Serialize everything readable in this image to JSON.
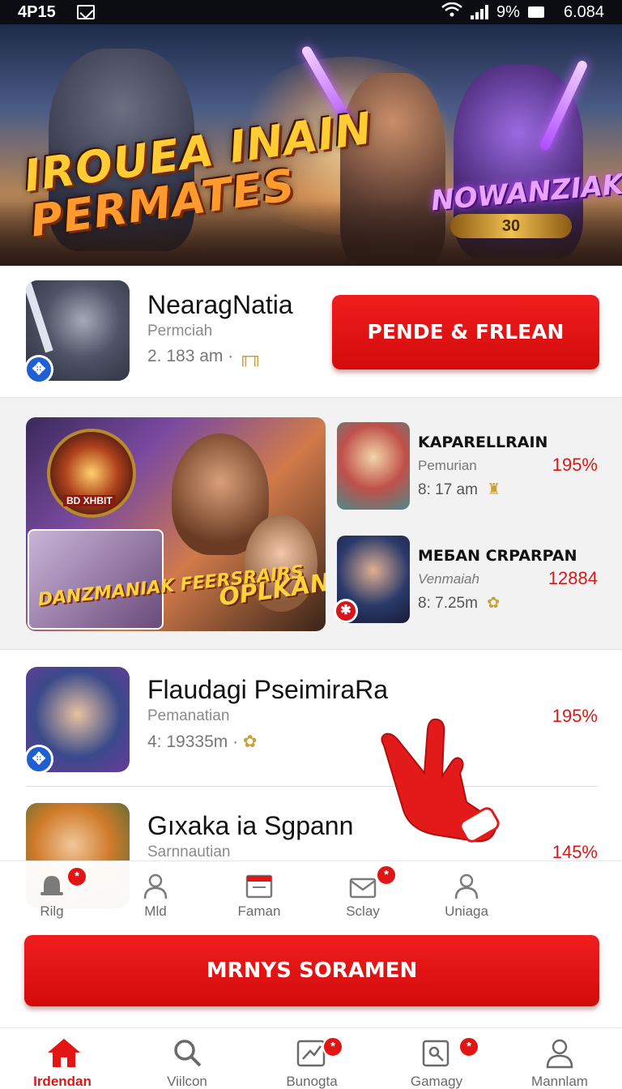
{
  "status_bar": {
    "time": "4P15",
    "battery": "9%",
    "right_text": "6.084"
  },
  "hero": {
    "title_line1": "IROUEA INAIN",
    "title_line2": "PERMATES",
    "badge": "NOWANZIAK",
    "coin": "30"
  },
  "featured": {
    "name": "NearagNatia",
    "subtitle": "Permciah",
    "meta": "2. 183 am ·",
    "button_label": "PENDE & FRLEAN"
  },
  "grid": {
    "banner_left_text": "DANZMANIAK FEERSRAIRS",
    "banner_right_text": "OPLKAN",
    "banner_shield_text": "BD XHBIT",
    "items": [
      {
        "title": "KAPARELLRAIN",
        "subtitle": "Pemurian",
        "meta": "8: 17 am",
        "percent": "195%"
      },
      {
        "title": "MEБAN CRPARPAN",
        "subtitle": "Venmaiah",
        "meta": "8: 7.25m",
        "percent": "12884"
      }
    ]
  },
  "list": [
    {
      "name": "Flaudagi PseimiraRa",
      "subtitle": "Pemanatian",
      "meta": "4: 19335m ·",
      "percent": "195%"
    },
    {
      "name": "Gıxaka ia Sgpann",
      "subtitle": "Sarnnautian",
      "meta": "",
      "percent": "145%"
    }
  ],
  "secondary_tabs": [
    {
      "label": "Rilg",
      "icon": "bell-icon",
      "badge": "*"
    },
    {
      "label": "Mld",
      "icon": "user-icon",
      "badge": ""
    },
    {
      "label": "Faman",
      "icon": "calendar-icon",
      "badge": ""
    },
    {
      "label": "Sclay",
      "icon": "mail-icon",
      "badge": "*"
    },
    {
      "label": "Uniaga",
      "icon": "profile-icon",
      "badge": ""
    }
  ],
  "cta_label": "MRNYS SORAMEN",
  "bottom_nav": [
    {
      "label": "Irdendan",
      "icon": "home-icon",
      "active": true,
      "badge": ""
    },
    {
      "label": "Viilcon",
      "icon": "search-icon",
      "active": false,
      "badge": ""
    },
    {
      "label": "Bunogta",
      "icon": "chart-icon",
      "active": false,
      "badge": "*"
    },
    {
      "label": "Gamagy",
      "icon": "tag-icon",
      "active": false,
      "badge": "*"
    },
    {
      "label": "Mannlam",
      "icon": "profile-icon",
      "active": false,
      "badge": ""
    }
  ],
  "colors": {
    "accent": "#e31414",
    "status_bar": "#0c0d12",
    "muted_text": "#8a8a8a"
  }
}
